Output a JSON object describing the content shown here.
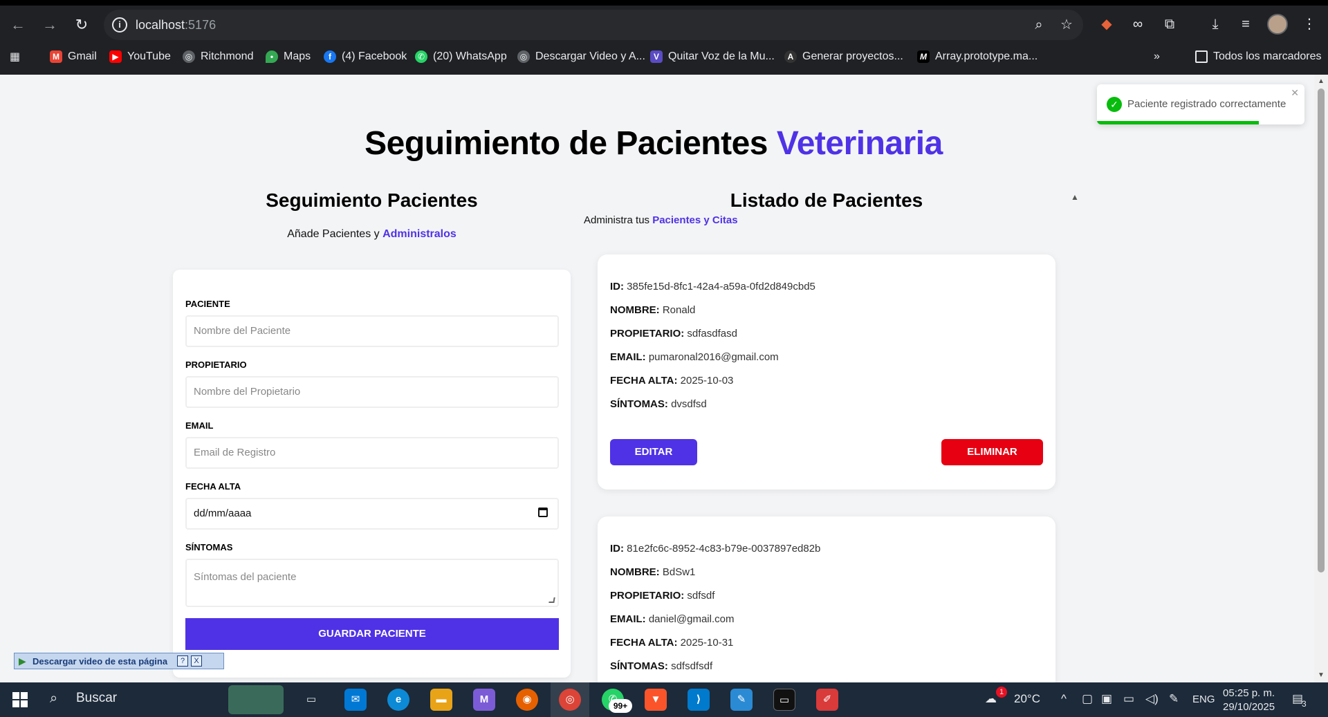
{
  "browser": {
    "url_host": "localhost",
    "url_port": ":5176",
    "bookmarks": [
      {
        "label": "Gmail",
        "icon": "gmail-icon",
        "color": "#ea4335"
      },
      {
        "label": "YouTube",
        "icon": "youtube-icon",
        "color": "#ff0000"
      },
      {
        "label": "Ritchmond",
        "icon": "globe-icon",
        "color": "#5f6368"
      },
      {
        "label": "Maps",
        "icon": "maps-icon",
        "color": "#34a853"
      },
      {
        "label": "(4) Facebook",
        "icon": "facebook-icon",
        "color": "#1877f2"
      },
      {
        "label": "(20) WhatsApp",
        "icon": "whatsapp-icon",
        "color": "#25d366"
      },
      {
        "label": "Descargar Video y A...",
        "icon": "globe-icon",
        "color": "#5f6368"
      },
      {
        "label": "Quitar Voz de la Mu...",
        "icon": "v-icon",
        "color": "#5b4bc4"
      },
      {
        "label": "Generar proyectos...",
        "icon": "generar-icon",
        "color": "#333333"
      },
      {
        "label": "Array.prototype.ma...",
        "icon": "mdn-icon",
        "color": "#000000"
      }
    ],
    "all_bookmarks": "Todos los marcadores"
  },
  "page": {
    "title_main": "Seguimiento de Pacientes ",
    "title_accent": "Veterinaria",
    "form_section": {
      "title": "Seguimiento Pacientes",
      "subtitle": "Añade Pacientes y ",
      "subtitle_bold": "Administralos"
    },
    "list_section": {
      "title": "Listado de Pacientes",
      "subtitle": "Administra tus ",
      "subtitle_bold": "Pacientes y Citas"
    },
    "form": {
      "paciente_label": "PACIENTE",
      "paciente_placeholder": "Nombre del Paciente",
      "propietario_label": "PROPIETARIO",
      "propietario_placeholder": "Nombre del Propietario",
      "email_label": "EMAIL",
      "email_placeholder": "Email de Registro",
      "fecha_label": "FECHA ALTA",
      "fecha_placeholder": "dd/mm/aaaa",
      "sintomas_label": "SÍNTOMAS",
      "sintomas_placeholder": "Síntomas del paciente",
      "submit_label": "GUARDAR PACIENTE"
    },
    "labels": {
      "id": "ID:",
      "nombre": "NOMBRE:",
      "propietario": "PROPIETARIO:",
      "email": "EMAIL:",
      "fecha": "FECHA ALTA:",
      "sintomas": "SÍNTOMAS:",
      "edit": "EDITAR",
      "delete": "ELIMINAR"
    },
    "patients": [
      {
        "id": "385fe15d-8fc1-42a4-a59a-0fd2d849cbd5",
        "nombre": "Ronald",
        "propietario": "sdfasdfasd",
        "email": "pumaronal2016@gmail.com",
        "fecha": "2025-10-03",
        "sintomas": "dvsdfsd"
      },
      {
        "id": "81e2fc6c-8952-4c83-b79e-0037897ed82b",
        "nombre": "BdSw1",
        "propietario": "sdfsdf",
        "email": "daniel@gmail.com",
        "fecha": "2025-10-31",
        "sintomas": "sdfsdfsdf"
      }
    ],
    "toast": {
      "message": "Paciente registrado correctamente",
      "progress": 0.78,
      "color": "#07bc0c"
    },
    "accent_color": "#4f32e6",
    "danger_color": "#e60012"
  },
  "download_bar": {
    "label": "Descargar video de esta página",
    "help": "?",
    "close": "X"
  },
  "taskbar": {
    "search_label": "Buscar",
    "badge": "99+",
    "weather_badge": "1",
    "temperature": "20°C",
    "language": "ENG",
    "time": "05:25 p. m.",
    "date": "29/10/2025",
    "notifications": "3"
  }
}
